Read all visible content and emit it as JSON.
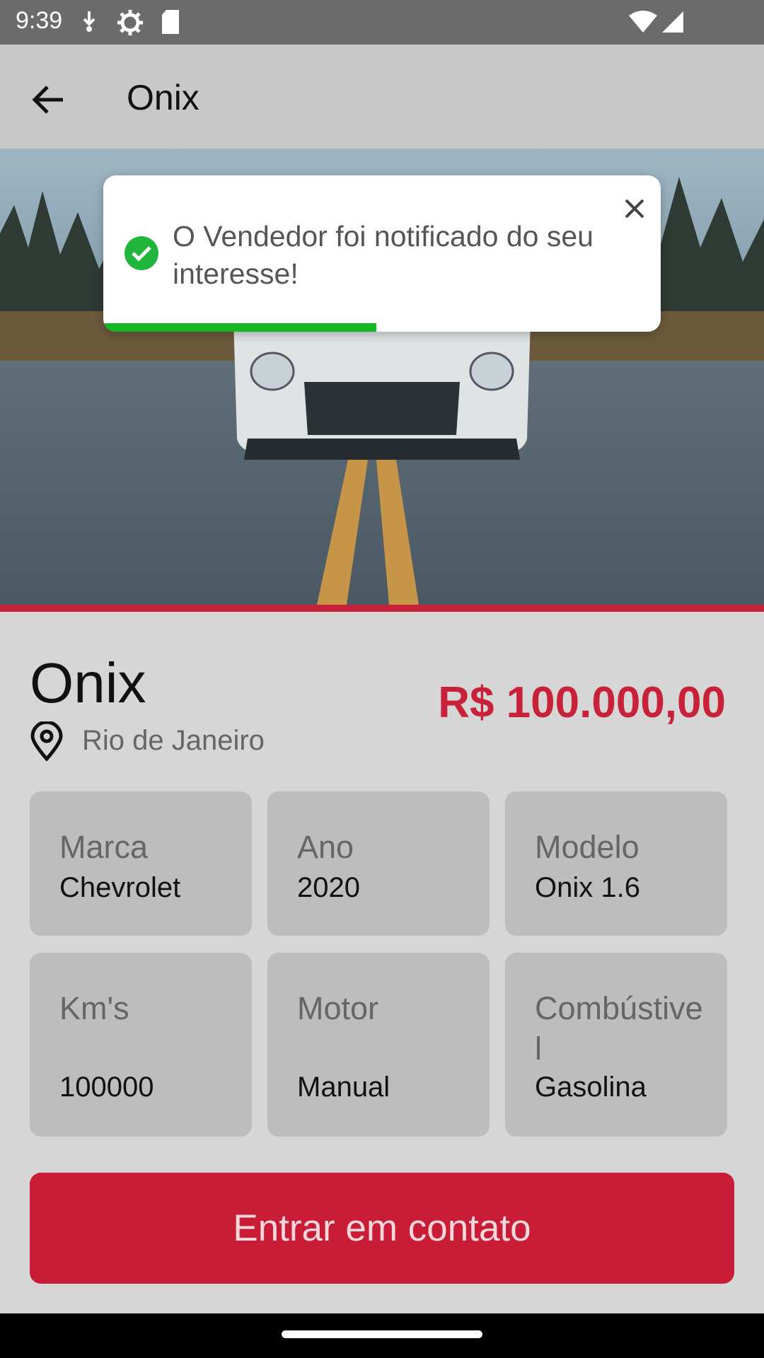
{
  "status_bar": {
    "time": "9:39",
    "icons": [
      "download-icon",
      "settings-icon",
      "sd-card-icon",
      "wifi-icon",
      "signal-icon"
    ]
  },
  "app_bar": {
    "title": "Onix",
    "back_icon": "arrow-back-icon"
  },
  "hero": {
    "image_description_icon": "car-photo",
    "carousel_dots": 3,
    "active_dot": 3
  },
  "toast": {
    "message": "O Vendedor foi notificado do seu interesse!",
    "progress_fraction": 0.49,
    "icon": "check-circle-icon",
    "close_icon": "close-icon"
  },
  "listing": {
    "name": "Onix",
    "location": "Rio de Janeiro",
    "price": "R$ 100.000,00"
  },
  "specs": [
    {
      "label": "Marca",
      "value": "Chevrolet"
    },
    {
      "label": "Ano",
      "value": "2020"
    },
    {
      "label": "Modelo",
      "value": "Onix 1.6"
    },
    {
      "label": "Km's",
      "value": "100000"
    },
    {
      "label": "Motor",
      "value": "Manual"
    },
    {
      "label": "Combústivel",
      "value": "Gasolina"
    }
  ],
  "cta": {
    "label": "Entrar em contato"
  },
  "colors": {
    "accent": "#c91c36",
    "success": "#13b722"
  }
}
